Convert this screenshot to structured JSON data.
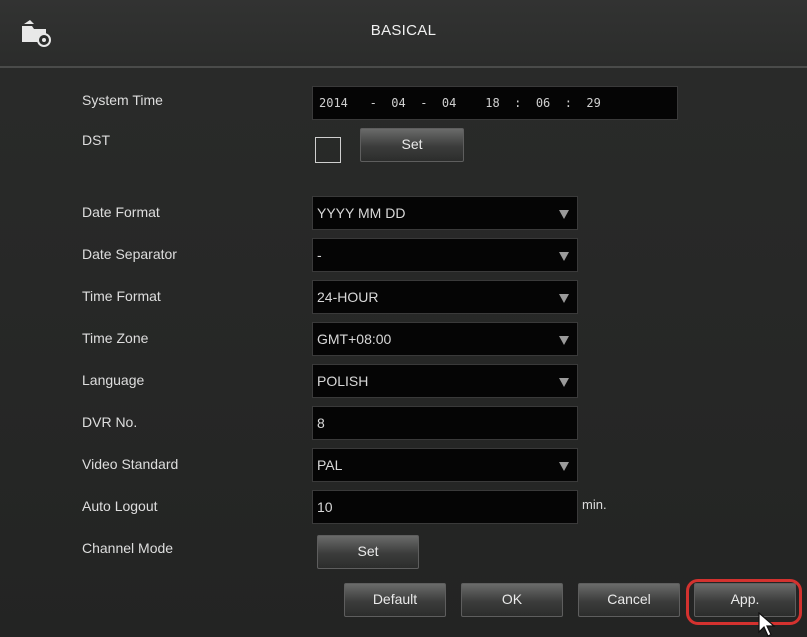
{
  "window": {
    "title": "BASICAL",
    "icon": "settings-folder-icon"
  },
  "system_time": {
    "label": "System Time",
    "year": "2014",
    "month": "04",
    "day": "04",
    "hour": "18",
    "minute": "06",
    "second": "29",
    "date_sep": "-",
    "time_sep": ":"
  },
  "dst": {
    "label": "DST",
    "checked": false,
    "set_label": "Set"
  },
  "date_format": {
    "label": "Date Format",
    "value": "YYYY MM DD"
  },
  "date_separator": {
    "label": "Date Separator",
    "value": "-"
  },
  "time_format": {
    "label": "Time Format",
    "value": "24-HOUR"
  },
  "time_zone": {
    "label": "Time Zone",
    "value": "GMT+08:00"
  },
  "language": {
    "label": "Language",
    "value": "POLISH"
  },
  "dvr_no": {
    "label": "DVR No.",
    "value": "8"
  },
  "video_standard": {
    "label": "Video Standard",
    "value": "PAL"
  },
  "auto_logout": {
    "label": "Auto Logout",
    "value": "10",
    "unit": "min."
  },
  "channel_mode": {
    "label": "Channel Mode",
    "set_label": "Set"
  },
  "buttons": {
    "default": "Default",
    "ok": "OK",
    "cancel": "Cancel",
    "apply": "App."
  },
  "colors": {
    "background": "#262726",
    "field": "#050505",
    "highlight": "#d3322f",
    "text": "#e6e6e6"
  }
}
